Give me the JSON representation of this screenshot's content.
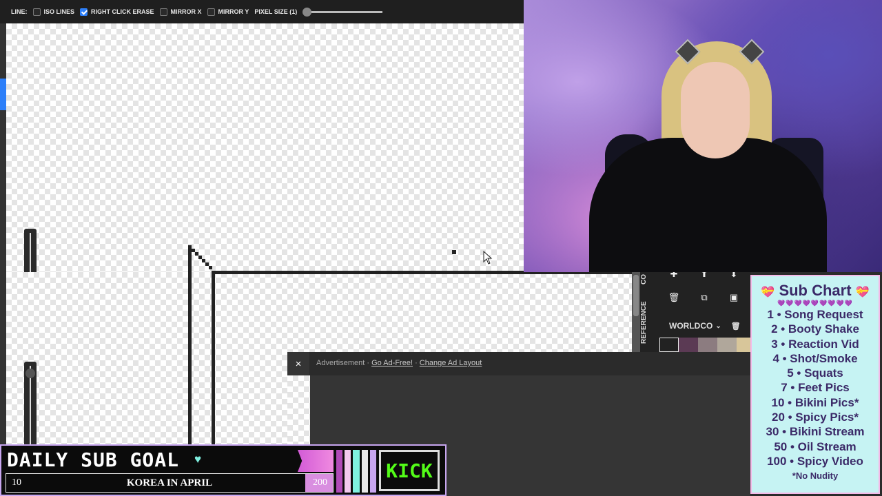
{
  "toolbar": {
    "line_label": "LINE:",
    "options": [
      {
        "label": "ISO LINES",
        "checked": false
      },
      {
        "label": "RIGHT CLICK ERASE",
        "checked": true
      },
      {
        "label": "MIRROR X",
        "checked": false
      },
      {
        "label": "MIRROR Y",
        "checked": false
      }
    ],
    "pixel_size_label": "PIXEL SIZE (1)",
    "pixel_size_value": 1
  },
  "side_panel": {
    "tab_top": "CO",
    "tab_reference": "REFERENCE",
    "palette_name": "WORLDCO",
    "icons": [
      "plus-icon",
      "up-arrow-icon",
      "down-arrow-icon",
      "trash-icon",
      "copy-icon",
      "export-icon",
      "trash-icon"
    ],
    "swatches": [
      "#222222",
      "#5b3a54",
      "#8c7c80",
      "#b0a79b",
      "#d8c69a",
      "#e6cf8f"
    ]
  },
  "ad": {
    "close": "×",
    "label": "Advertisement",
    "separator": " · ",
    "go_ad_free": "Go Ad-Free!",
    "change_layout": "Change Ad Layout"
  },
  "sub_chart": {
    "title": "Sub Chart",
    "hearts": "💜💜💜💜💜💜💜💜💜",
    "items": [
      "1 • Song Request",
      "2 • Booty Shake",
      "3 • Reaction Vid",
      "4 • Shot/Smoke",
      "5 • Squats",
      "7 • Feet Pics",
      "10 • Bikini Pics*",
      "20 • Spicy Pics*",
      "30 • Bikini Stream",
      "50 • Oil Stream",
      "100 • Spicy Video"
    ],
    "note": "*No Nudity"
  },
  "goal": {
    "title": "DAILY SUB GOAL",
    "start": "10",
    "label": "KOREA IN APRIL",
    "end": "200",
    "progress_fraction": 0.0,
    "platform": "KICK"
  },
  "colors": {
    "accent": "#2d7ff9",
    "kick_green": "#53fc18",
    "sub_chart_bg": "#c6f3f3",
    "goal_pink": "#d25bd6"
  }
}
